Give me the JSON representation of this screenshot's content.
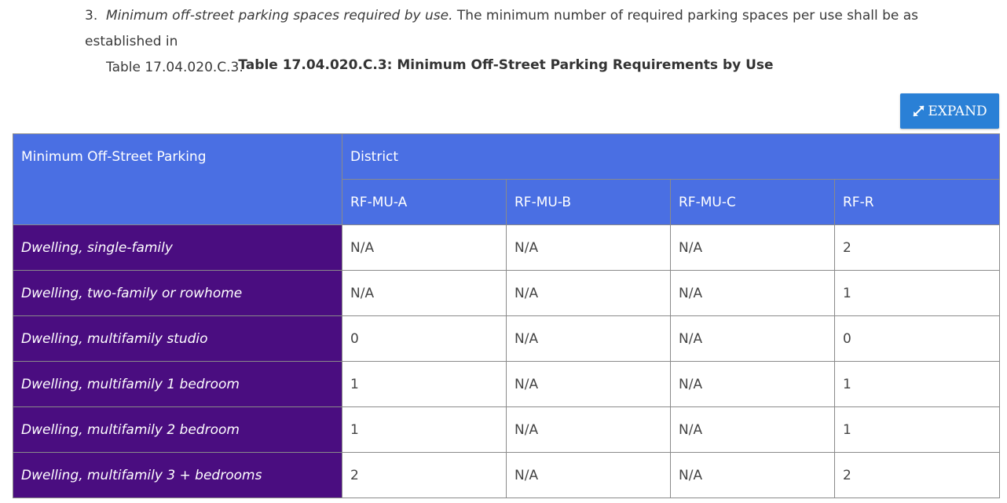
{
  "paragraph": {
    "number": "3.",
    "italic_lead": "Minimum off-street parking spaces required by use.",
    "text_line1": " The minimum number of required parking spaces per use shall be as established in",
    "text_line2": "Table 17.04.020.C.3."
  },
  "table_caption": "Table 17.04.020.C.3: Minimum Off-Street Parking Requirements by Use",
  "expand_button": {
    "label": "EXPAND",
    "icon": "expand-arrows-icon"
  },
  "colors": {
    "header_bg": "#4a6fe3",
    "use_col_bg": "#4a0d80",
    "button_bg": "#2a80d6"
  },
  "table": {
    "corner_header": "Minimum Off-Street Parking",
    "group_header": "District",
    "columns": [
      "RF-MU-A",
      "RF-MU-B",
      "RF-MU-C",
      "RF-R"
    ],
    "rows": [
      {
        "use": "Dwelling, single-family",
        "values": [
          "N/A",
          "N/A",
          "N/A",
          "2"
        ]
      },
      {
        "use": "Dwelling, two-family or rowhome",
        "values": [
          "N/A",
          "N/A",
          "N/A",
          "1"
        ]
      },
      {
        "use": "Dwelling, multifamily studio",
        "values": [
          "0",
          "N/A",
          "N/A",
          "0"
        ]
      },
      {
        "use": "Dwelling, multifamily 1 bedroom",
        "values": [
          "1",
          "N/A",
          "N/A",
          "1"
        ]
      },
      {
        "use": "Dwelling, multifamily 2 bedroom",
        "values": [
          "1",
          "N/A",
          "N/A",
          "1"
        ]
      },
      {
        "use": "Dwelling, multifamily 3 + bedrooms",
        "values": [
          "2",
          "N/A",
          "N/A",
          "2"
        ]
      }
    ]
  }
}
